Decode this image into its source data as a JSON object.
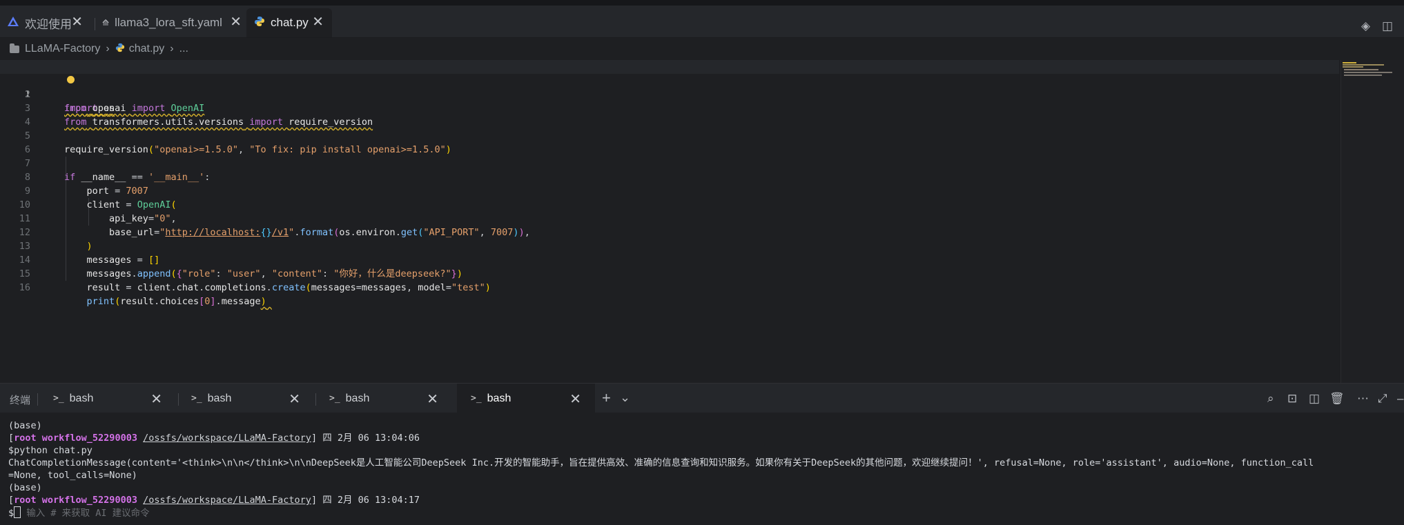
{
  "tabs": [
    {
      "label": "欢迎使用",
      "icon": "app-logo-icon",
      "active": false
    },
    {
      "label": "llama3_lora_sft.yaml",
      "icon": "yaml-file-icon",
      "active": false
    },
    {
      "label": "chat.py",
      "icon": "python-file-icon",
      "active": true
    }
  ],
  "breadcrumb": {
    "root": "LLaMA-Factory",
    "file": "chat.py",
    "more": "..."
  },
  "editor": {
    "line_numbers": [
      "1",
      "2",
      "3",
      "4",
      "5",
      "6",
      "7",
      "8",
      "9",
      "10",
      "11",
      "12",
      "13",
      "14",
      "15",
      "16"
    ],
    "current_line": 1,
    "lines": [
      "import os",
      "from openai import OpenAI",
      "from transformers.utils.versions import require_version",
      "",
      "require_version(\"openai>=1.5.0\", \"To fix: pip install openai>=1.5.0\")",
      "",
      "if __name__ == '__main__':",
      "    port = 7007",
      "    client = OpenAI(",
      "        api_key=\"0\",",
      "        base_url=\"http://localhost:{}/v1\".format(os.environ.get(\"API_PORT\", 7007)),",
      "    )",
      "    messages = []",
      "    messages.append({\"role\": \"user\", \"content\": \"你好，什么是deepseek?\"})",
      "    result = client.chat.completions.create(messages=messages, model=\"test\")",
      "    print(result.choices[0].message)"
    ]
  },
  "terminal": {
    "label": "终端",
    "tabs": [
      {
        "label": "bash",
        "active": false
      },
      {
        "label": "bash",
        "active": false
      },
      {
        "label": "bash",
        "active": false
      },
      {
        "label": "bash",
        "active": true
      }
    ],
    "output": {
      "l1": "(base)",
      "l2_pre": "[",
      "l2_user": "root workflow_52290003",
      "l2_path": "/ossfs/workspace/LLaMA-Factory",
      "l2_post": "] 四 2月 06 13:04:06",
      "l3": "$python chat.py",
      "l4": "ChatCompletionMessage(content='<think>\\n\\n</think>\\n\\nDeepSeek是人工智能公司DeepSeek Inc.开发的智能助手，旨在提供高效、准确的信息查询和知识服务。如果你有关于DeepSeek的其他问题，欢迎继续提问！', refusal=None, role='assistant', audio=None, function_call",
      "l5": "=None, tool_calls=None)",
      "l6": "(base)",
      "l7_pre": "[",
      "l7_user": "root workflow_52290003",
      "l7_path": "/ossfs/workspace/LLaMA-Factory",
      "l7_post": "] 四 2月 06 13:04:17",
      "prompt": "$",
      "placeholder": "输入 # 来获取 AI 建议命令"
    }
  },
  "colors": {
    "keyword": "#c678dd",
    "string": "#e5a06b",
    "function": "#80c2ff",
    "terminal_user": "#d472e8"
  }
}
